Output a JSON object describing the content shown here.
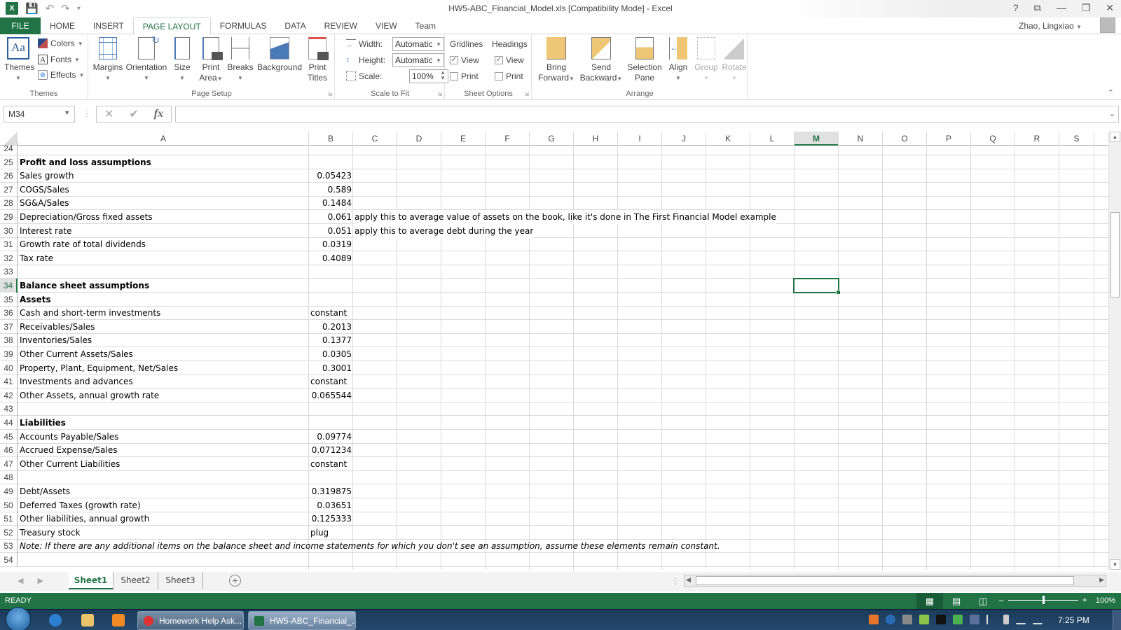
{
  "titlebar": {
    "title": "HW5-ABC_Financial_Model.xls  [Compatibility Mode] - Excel",
    "qat": [
      "excel-logo",
      "save-icon",
      "undo-icon",
      "redo-icon",
      "customize-qat-icon"
    ],
    "controls": [
      "?",
      "⧉",
      "—",
      "❐",
      "✕"
    ]
  },
  "tabs": [
    {
      "label": "FILE"
    },
    {
      "label": "HOME"
    },
    {
      "label": "INSERT"
    },
    {
      "label": "PAGE LAYOUT",
      "active": true
    },
    {
      "label": "FORMULAS"
    },
    {
      "label": "DATA"
    },
    {
      "label": "REVIEW"
    },
    {
      "label": "VIEW"
    },
    {
      "label": "Team"
    }
  ],
  "user": {
    "name": "Zhao, Lingxiao"
  },
  "ribbon": {
    "themes": {
      "label": "Themes",
      "themes_btn": "Themes",
      "colors": "Colors",
      "fonts": "Fonts",
      "effects": "Effects"
    },
    "page_setup": {
      "label": "Page Setup",
      "margins": "Margins",
      "orientation": "Orientation",
      "size": "Size",
      "print_area_1": "Print",
      "print_area_2": "Area",
      "breaks": "Breaks",
      "background": "Background",
      "print_titles_1": "Print",
      "print_titles_2": "Titles"
    },
    "scale_to_fit": {
      "label": "Scale to Fit",
      "width_label": "Width:",
      "width_value": "Automatic",
      "height_label": "Height:",
      "height_value": "Automatic",
      "scale_label": "Scale:",
      "scale_value": "100%"
    },
    "sheet_options": {
      "label": "Sheet Options",
      "gridlines": "Gridlines",
      "headings": "Headings",
      "view": "View",
      "print": "Print",
      "gridlines_view": true,
      "gridlines_print": false,
      "headings_view": true,
      "headings_print": false
    },
    "arrange": {
      "label": "Arrange",
      "bring_forward_1": "Bring",
      "bring_forward_2": "Forward",
      "send_backward_1": "Send",
      "send_backward_2": "Backward",
      "selection_pane_1": "Selection",
      "selection_pane_2": "Pane",
      "align": "Align",
      "group": "Group",
      "rotate": "Rotate"
    }
  },
  "formula_bar": {
    "name_box": "M34",
    "formula": ""
  },
  "columns": [
    "A",
    "B",
    "C",
    "D",
    "E",
    "F",
    "G",
    "H",
    "I",
    "J",
    "K",
    "L",
    "M",
    "N",
    "O",
    "P",
    "Q",
    "R",
    "S"
  ],
  "selected_column": "M",
  "selected_row": "34",
  "rows": [
    {
      "n": "24",
      "a": "",
      "b": "",
      "c": ""
    },
    {
      "n": "25",
      "a": "Profit and loss assumptions",
      "b": "",
      "c": "",
      "style": "bold"
    },
    {
      "n": "26",
      "a": "Sales growth",
      "b": "0.05423",
      "c": ""
    },
    {
      "n": "27",
      "a": "COGS/Sales",
      "b": "0.589",
      "c": ""
    },
    {
      "n": "28",
      "a": "SG&A/Sales",
      "b": "0.1484",
      "c": ""
    },
    {
      "n": "29",
      "a": "Depreciation/Gross fixed assets",
      "b": "0.061",
      "c": "apply this to average value of assets on the book, like it's done in The First Financial Model example"
    },
    {
      "n": "30",
      "a": "Interest rate",
      "b": "0.051",
      "c": "apply this to average debt during the year"
    },
    {
      "n": "31",
      "a": "Growth rate of total dividends",
      "b": "0.0319",
      "c": ""
    },
    {
      "n": "32",
      "a": "Tax rate",
      "b": "0.4089",
      "c": ""
    },
    {
      "n": "33",
      "a": "",
      "b": "",
      "c": ""
    },
    {
      "n": "34",
      "a": "Balance sheet assumptions",
      "b": "",
      "c": "",
      "style": "bold"
    },
    {
      "n": "35",
      "a": "Assets",
      "b": "",
      "c": "",
      "style": "bold"
    },
    {
      "n": "36",
      "a": "Cash and short-term investments",
      "b": "constant",
      "c": "",
      "btype": "txt"
    },
    {
      "n": "37",
      "a": "Receivables/Sales",
      "b": "0.2013",
      "c": ""
    },
    {
      "n": "38",
      "a": "Inventories/Sales",
      "b": "0.1377",
      "c": ""
    },
    {
      "n": "39",
      "a": "Other Current Assets/Sales",
      "b": "0.0305",
      "c": ""
    },
    {
      "n": "40",
      "a": "Property, Plant, Equipment, Net/Sales",
      "b": "0.3001",
      "c": ""
    },
    {
      "n": "41",
      "a": "Investments and advances",
      "b": "constant",
      "c": "",
      "btype": "txt"
    },
    {
      "n": "42",
      "a": "Other Assets, annual growth rate",
      "b": "0.065544",
      "c": ""
    },
    {
      "n": "43",
      "a": "",
      "b": "",
      "c": ""
    },
    {
      "n": "44",
      "a": "Liabilities",
      "b": "",
      "c": "",
      "style": "bold"
    },
    {
      "n": "45",
      "a": "Accounts Payable/Sales",
      "b": "0.09774",
      "c": ""
    },
    {
      "n": "46",
      "a": "Accrued Expense/Sales",
      "b": "0.071234",
      "c": ""
    },
    {
      "n": "47",
      "a": "Other Current Liabilities",
      "b": "constant",
      "c": "",
      "btype": "txt"
    },
    {
      "n": "48",
      "a": "",
      "b": "",
      "c": ""
    },
    {
      "n": "49",
      "a": "Debt/Assets",
      "b": "0.319875",
      "c": ""
    },
    {
      "n": "50",
      "a": "Deferred Taxes (growth rate)",
      "b": "0.03651",
      "c": ""
    },
    {
      "n": "51",
      "a": "Other liabilities, annual growth",
      "b": "0.125333",
      "c": ""
    },
    {
      "n": "52",
      "a": "Treasury stock",
      "b": "plug",
      "c": "",
      "btype": "txt"
    },
    {
      "n": "53",
      "a": "Note: If there are any additional items on the balance sheet and income statements for which you don't see an assumption, assume these elements remain constant.",
      "b": "",
      "c": "",
      "style": "italic"
    },
    {
      "n": "54",
      "a": "",
      "b": "",
      "c": ""
    }
  ],
  "sheets": [
    {
      "label": "Sheet1",
      "active": true
    },
    {
      "label": "Sheet2"
    },
    {
      "label": "Sheet3"
    }
  ],
  "status": {
    "mode": "READY",
    "zoom": "100%",
    "zoom_fraction": 0.5
  },
  "taskbar": {
    "tasks": [
      {
        "label": "Homework Help Ask..."
      },
      {
        "label": "HW5-ABC_Financial_..."
      }
    ],
    "clock": "7:25 PM"
  },
  "colors": {
    "excel_green": "#217346",
    "taskbar": "#1c3b5a"
  }
}
